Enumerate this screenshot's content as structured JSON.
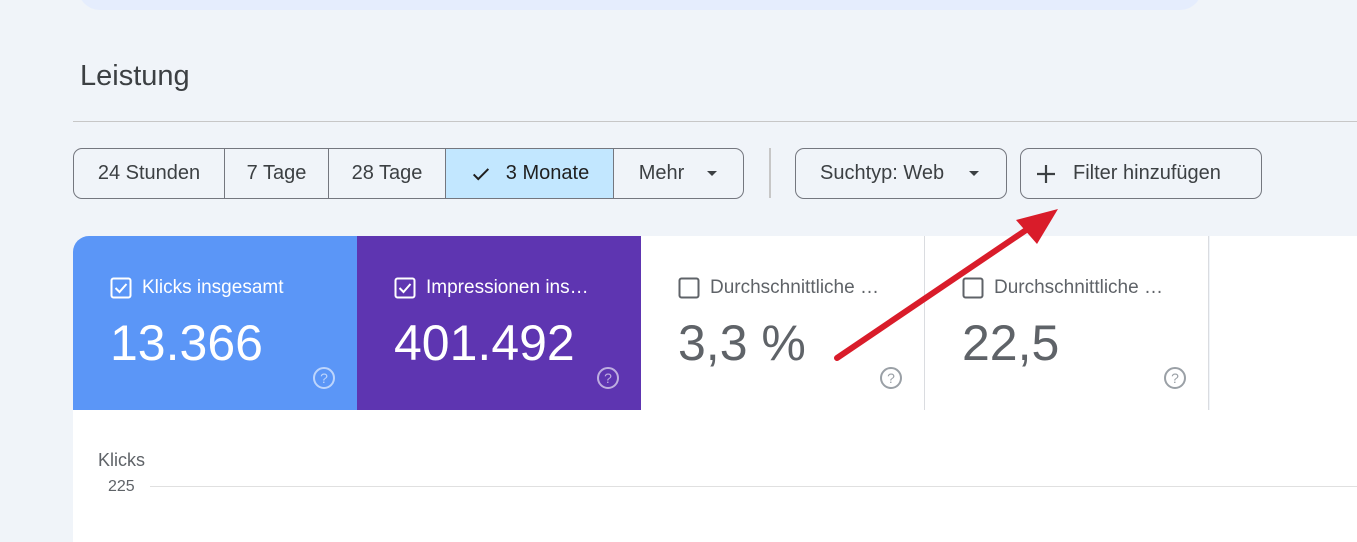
{
  "page_title": "Leistung",
  "date_range": {
    "options": [
      "24 Stunden",
      "7 Tage",
      "28 Tage",
      "3 Monate"
    ],
    "selected": "3 Monate",
    "more_label": "Mehr"
  },
  "search_type_label": "Suchtyp: Web",
  "add_filter_label": "Filter hinzufügen",
  "metrics": [
    {
      "label": "Klicks insgesamt",
      "value": "13.366",
      "checked": true,
      "color": "#5b96f7"
    },
    {
      "label": "Impressionen insgesamt",
      "value": "401.492",
      "checked": true,
      "color": "#5e35b1"
    },
    {
      "label": "Durchschnittliche CTR",
      "value": "3,3 %",
      "checked": false
    },
    {
      "label": "Durchschnittliche Position",
      "value": "22,5",
      "checked": false
    }
  ],
  "chart": {
    "y_title": "Klicks",
    "y_tick_top": "225"
  },
  "annotation_arrow_color": "#d91c2a"
}
